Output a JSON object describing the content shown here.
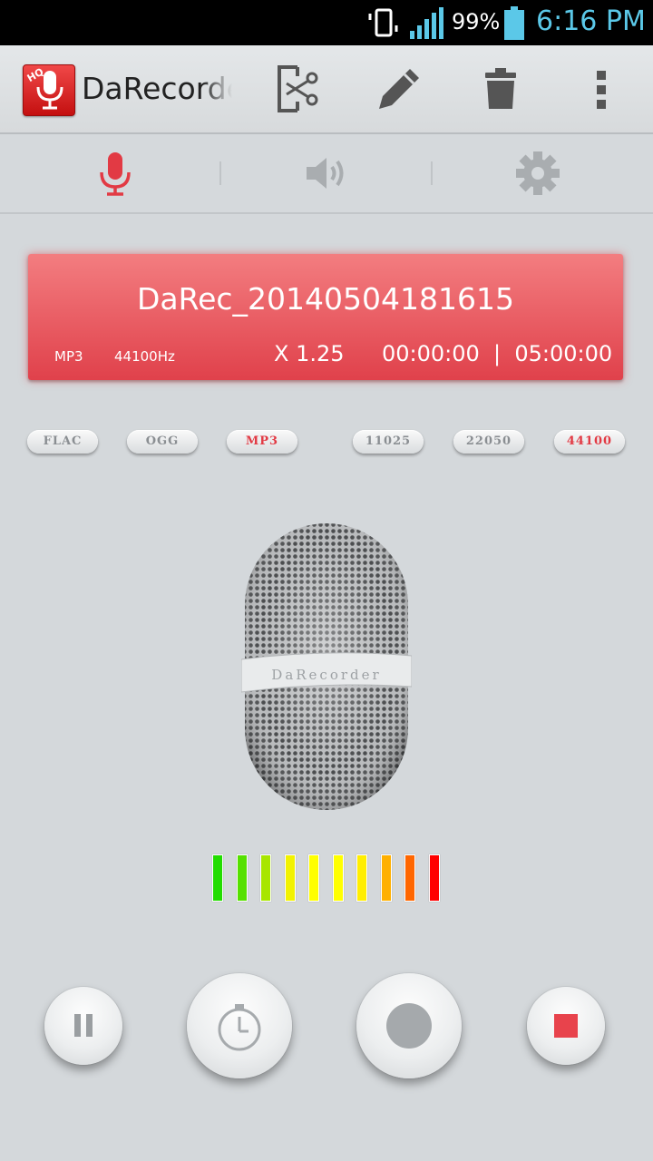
{
  "status_bar": {
    "battery_percent": "99%",
    "time": "6:16 PM",
    "icons": [
      "vibrate-icon",
      "signal-icon",
      "battery-icon"
    ]
  },
  "action_bar": {
    "app_title": "DaRecorder",
    "app_icon_badge": "HQ",
    "actions": [
      "trim-icon",
      "edit-icon",
      "delete-icon",
      "overflow-menu-icon"
    ]
  },
  "tabs": [
    {
      "icon": "microphone-icon",
      "active": true
    },
    {
      "icon": "speaker-icon",
      "active": false
    },
    {
      "icon": "gear-icon",
      "active": false
    }
  ],
  "recording": {
    "file_name": "DaRec_20140504181615",
    "format": "MP3",
    "sample_rate": "44100Hz",
    "speed": "X 1.25",
    "time": "00:00:00  |  05:00:00"
  },
  "formats": [
    {
      "label": "FLAC",
      "active": false
    },
    {
      "label": "OGG",
      "active": false
    },
    {
      "label": "MP3",
      "active": true
    }
  ],
  "sample_rates": [
    {
      "label": "11025",
      "active": false
    },
    {
      "label": "22050",
      "active": false
    },
    {
      "label": "44100",
      "active": true
    }
  ],
  "mic_brand": "DaRecorder",
  "level_meter": {
    "colors": [
      "#22dd00",
      "#55e000",
      "#a8e600",
      "#f2f200",
      "#ffff00",
      "#ffff00",
      "#ffee00",
      "#ffb000",
      "#ff6600",
      "#ff0000"
    ]
  },
  "controls": [
    "pause-button",
    "timer-button",
    "record-button",
    "stop-button"
  ],
  "colors": {
    "accent": "#e23a44",
    "time_text": "#5bc8e8"
  }
}
